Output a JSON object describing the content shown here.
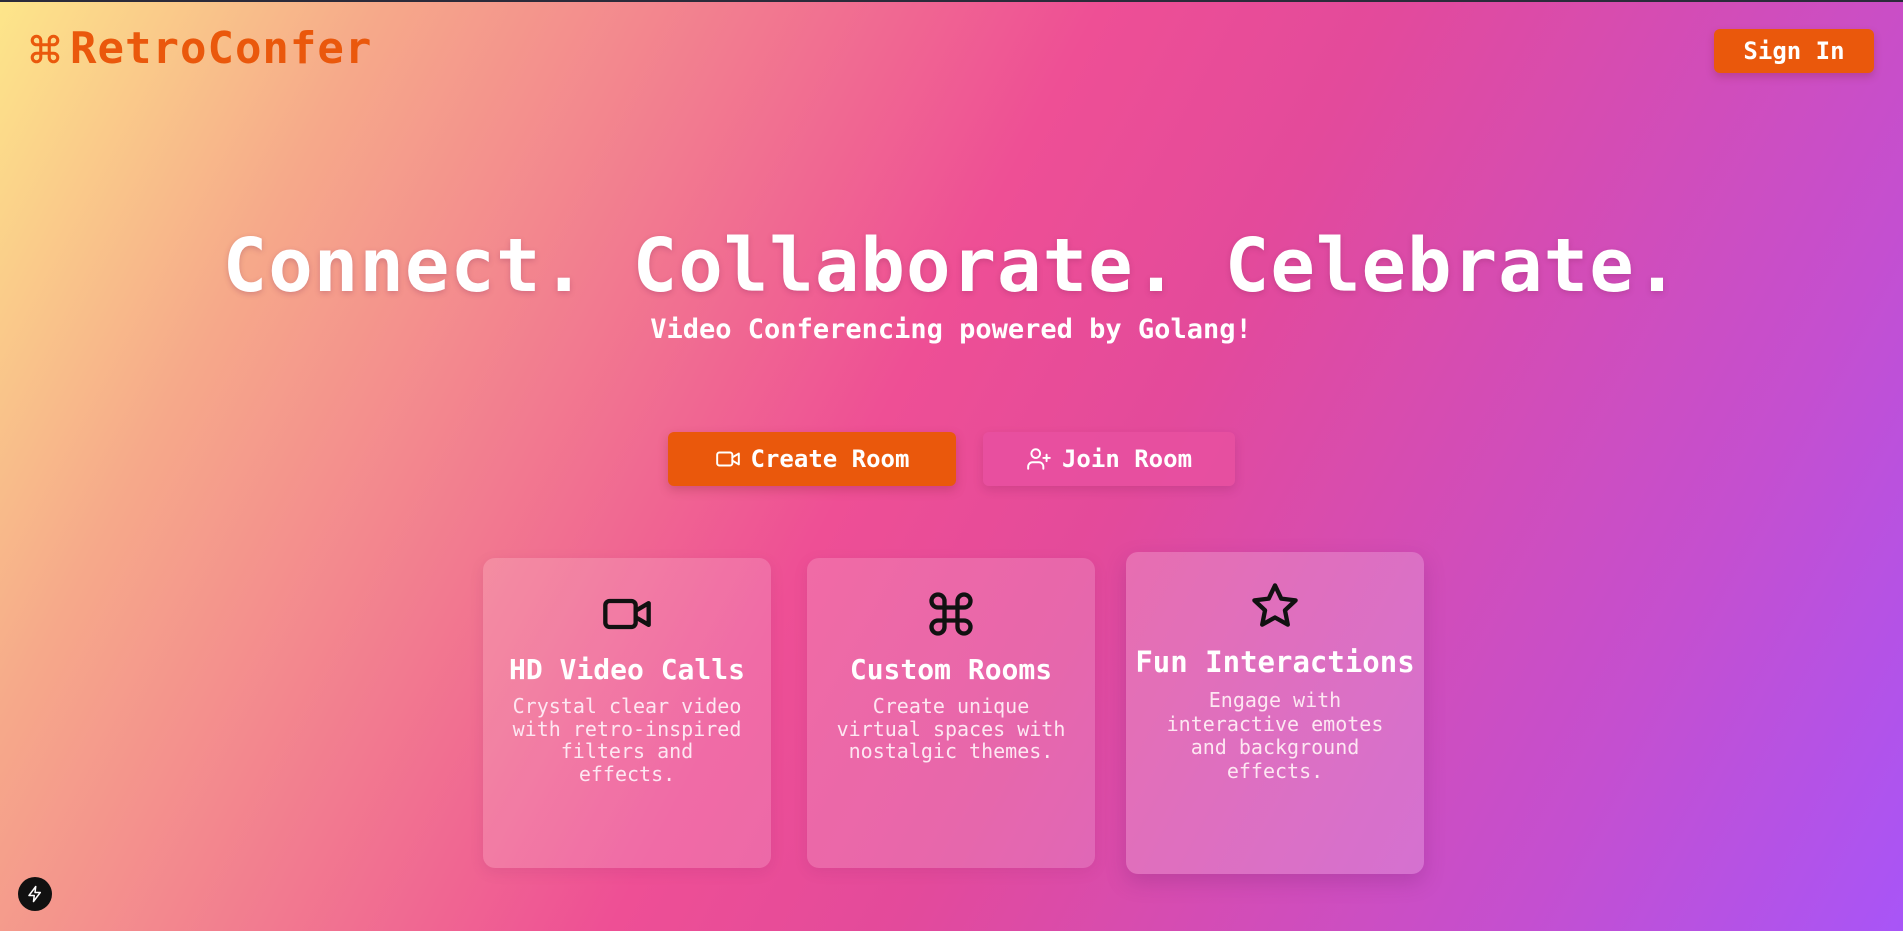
{
  "header": {
    "brand_name": "RetroConfer",
    "brand_icon": "command-icon",
    "signin_label": "Sign In"
  },
  "hero": {
    "title": "Connect. Collaborate. Celebrate.",
    "subtitle": "Video Conferencing powered by Golang!"
  },
  "actions": {
    "create_label": "Create Room",
    "create_icon": "video-camera-icon",
    "join_label": "Join Room",
    "join_icon": "user-plus-icon"
  },
  "features": [
    {
      "icon": "video-camera-icon",
      "title": "HD Video Calls",
      "description": "Crystal clear video with retro-inspired filters and effects."
    },
    {
      "icon": "command-icon",
      "title": "Custom Rooms",
      "description": "Create unique virtual spaces with nostalgic themes."
    },
    {
      "icon": "star-icon",
      "title": "Fun Interactions",
      "description": "Engage with interactive emotes and background effects."
    }
  ],
  "floating_button_icon": "lightning-bolt-icon",
  "colors": {
    "accent": "#ea580c",
    "gradient_start": "#fde68a",
    "gradient_mid": "#ec4899",
    "gradient_end": "#a855f7"
  }
}
